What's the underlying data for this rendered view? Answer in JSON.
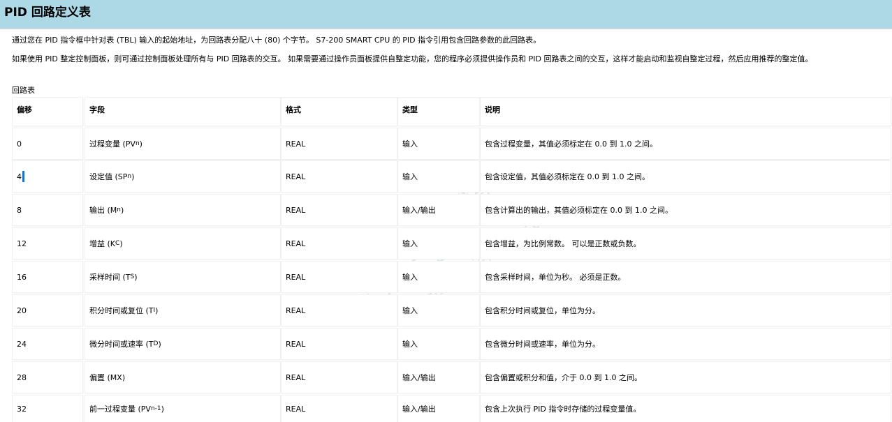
{
  "page": {
    "title": "PID 回路定义表",
    "intro": "通过您在 PID 指令框中针对表 (TBL) 输入的起始地址，为回路表分配八十 (80) 个字节。 S7-200 SMART CPU 的 PID 指令引用包含回路参数的此回路表。",
    "note": "如果使用 PID 整定控制面板，则可通过控制面板处理所有与 PID 回路表的交互。 如果需要通过操作员面板提供自整定功能，您的程序必须提供操作员和 PID 回路表之间的交互，这样才能启动和监视自整定过程，然后应用推荐的整定值。",
    "table_caption": "回路表"
  },
  "watermark": {
    "line1": "西门子工业",
    "line2": "support.industry.siemens.com/cs",
    "line3": "找答案"
  },
  "table": {
    "headers": [
      "偏移",
      "字段",
      "格式",
      "类型",
      "说明"
    ],
    "rows": [
      {
        "offset": "0",
        "field": "过程变量 (PV",
        "field_sub": "n",
        "field_end": ")",
        "format": "REAL",
        "type": "输入",
        "desc": "包含过程变量，其值必须标定在 0.0 到 1.0 之间。"
      },
      {
        "offset": "4",
        "field": "设定值 (SP",
        "field_sub": "n",
        "field_end": ")",
        "format": "REAL",
        "type": "输入",
        "desc": "包含设定值，其值必须标定在 0.0 到 1.0 之间。"
      },
      {
        "offset": "8",
        "field": "输出 (M",
        "field_sub": "n",
        "field_end": ")",
        "format": "REAL",
        "type": "输入/输出",
        "desc": "包含计算出的输出，其值必须标定在 0.0 到 1.0 之间。"
      },
      {
        "offset": "12",
        "field": "增益 (K",
        "field_sub": "C",
        "field_end": ")",
        "format": "REAL",
        "type": "输入",
        "desc": "包含增益，为比例常数。 可以是正数或负数。"
      },
      {
        "offset": "16",
        "field": "采样时间 (T",
        "field_sub": "S",
        "field_end": ")",
        "format": "REAL",
        "type": "输入",
        "desc": "包含采样时间，单位为秒。 必须是正数。"
      },
      {
        "offset": "20",
        "field": "积分时间或复位 (T",
        "field_sub": "I",
        "field_end": ")",
        "format": "REAL",
        "type": "输入",
        "desc": "包含积分时间或复位，单位为分。"
      },
      {
        "offset": "24",
        "field": "微分时间或速率 (T",
        "field_sub": "D",
        "field_end": ")",
        "format": "REAL",
        "type": "输入",
        "desc": "包含微分时间或速率，单位为分。"
      },
      {
        "offset": "28",
        "field": "偏置 (MX)",
        "field_sub": "",
        "field_end": "",
        "format": "REAL",
        "type": "输入/输出",
        "desc": "包含偏置或积分和值，介于 0.0 到 1.0 之间。"
      },
      {
        "offset": "32",
        "field": "前一过程变量 (PV",
        "field_sub": "n-1",
        "field_end": ")",
        "format": "REAL",
        "type": "输入/输出",
        "desc": "包含上次执行 PID 指令时存储的过程变量值。"
      }
    ]
  }
}
